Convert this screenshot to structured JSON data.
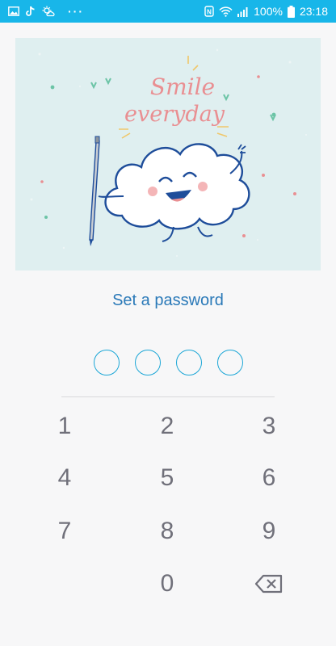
{
  "status_bar": {
    "background": "#18b6e9",
    "left_icons": [
      "gallery-icon",
      "tiktok-icon",
      "weather-icon"
    ],
    "more": "···",
    "right_icons": [
      "nfc-icon",
      "wifi-icon",
      "signal-icon",
      "battery-icon"
    ],
    "battery_percent": "100%",
    "time": "23:18"
  },
  "hero": {
    "line1": "Smile",
    "line2": "everyday",
    "colors": {
      "background": "#dfeff0",
      "text": "#e98f92",
      "outline": "#1e4d9a"
    }
  },
  "prompt": "Set a password",
  "pin": {
    "length": 4,
    "entered": 0,
    "ring_color": "#1aa6d6"
  },
  "keypad": {
    "k1": "1",
    "k2": "2",
    "k3": "3",
    "k4": "4",
    "k5": "5",
    "k6": "6",
    "k7": "7",
    "k8": "8",
    "k9": "9",
    "k0": "0",
    "backspace_icon": "backspace-icon"
  }
}
